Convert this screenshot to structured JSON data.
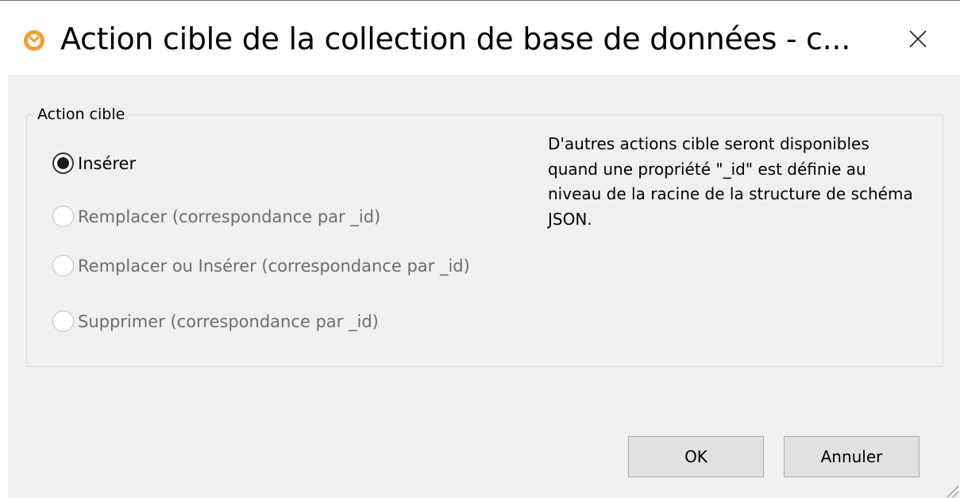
{
  "window": {
    "title": "Action cible de la collection de base de données - c...",
    "app_icon": "altova-clock-icon",
    "close_icon": "close-icon"
  },
  "group": {
    "legend": "Action cible",
    "options": [
      {
        "label": "Insérer",
        "checked": true,
        "enabled": true
      },
      {
        "label": "Remplacer (correspondance par _id)",
        "checked": false,
        "enabled": false
      },
      {
        "label": "Remplacer ou Insérer (correspondance par _id)",
        "checked": false,
        "enabled": false
      },
      {
        "label": "Supprimer (correspondance par _id)",
        "checked": false,
        "enabled": false
      }
    ],
    "info": "D'autres actions cible seront disponibles quand une propriété \"_id\" est définie au niveau de la racine de la structure de schéma JSON."
  },
  "buttons": {
    "ok": "OK",
    "cancel": "Annuler"
  },
  "colors": {
    "app_icon_orange": "#f0a030",
    "dialog_bg": "#f0f0f0",
    "disabled_text": "#6d6d6d",
    "button_bg": "#e1e1e1"
  }
}
